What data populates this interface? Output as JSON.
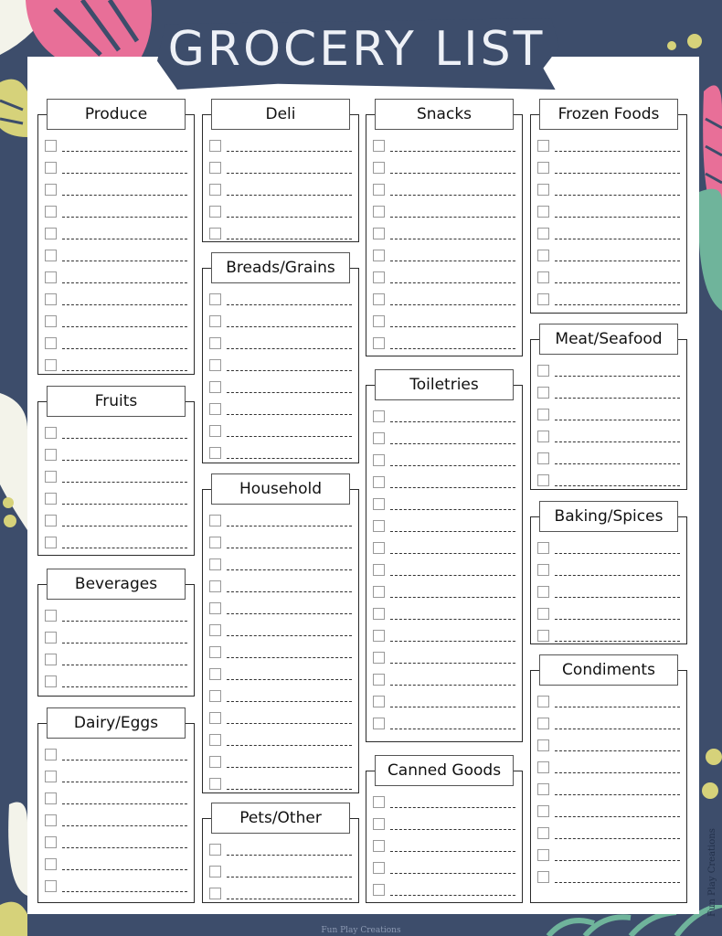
{
  "title": "GROCERY LIST",
  "colors": {
    "background": "#3d4d6b",
    "paper": "#ffffff",
    "title_text": "#eef1f7",
    "leaf_pink": "#e86f98",
    "leaf_green": "#6fb49b",
    "leaf_yellow": "#d6d27a",
    "leaf_cream": "#f3f3ea"
  },
  "columns": [
    [
      {
        "label": "Produce",
        "rows": 11
      },
      {
        "label": "Fruits",
        "rows": 6
      },
      {
        "label": "Beverages",
        "rows": 4
      },
      {
        "label": "Dairy/Eggs",
        "rows": 7
      }
    ],
    [
      {
        "label": "Deli",
        "rows": 5
      },
      {
        "label": "Breads/Grains",
        "rows": 8
      },
      {
        "label": "Household",
        "rows": 13
      },
      {
        "label": "Pets/Other",
        "rows": 3
      }
    ],
    [
      {
        "label": "Snacks",
        "rows": 10
      },
      {
        "label": "Toiletries",
        "rows": 15
      },
      {
        "label": "Canned Goods",
        "rows": 5
      }
    ],
    [
      {
        "label": "Frozen Foods",
        "rows": 8
      },
      {
        "label": "Meat/Seafood",
        "rows": 6
      },
      {
        "label": "Baking/Spices",
        "rows": 5
      },
      {
        "label": "Condiments",
        "rows": 9
      }
    ]
  ],
  "credit_side": "Fun Play Creations",
  "credit_bottom": "Fun Play Creations"
}
